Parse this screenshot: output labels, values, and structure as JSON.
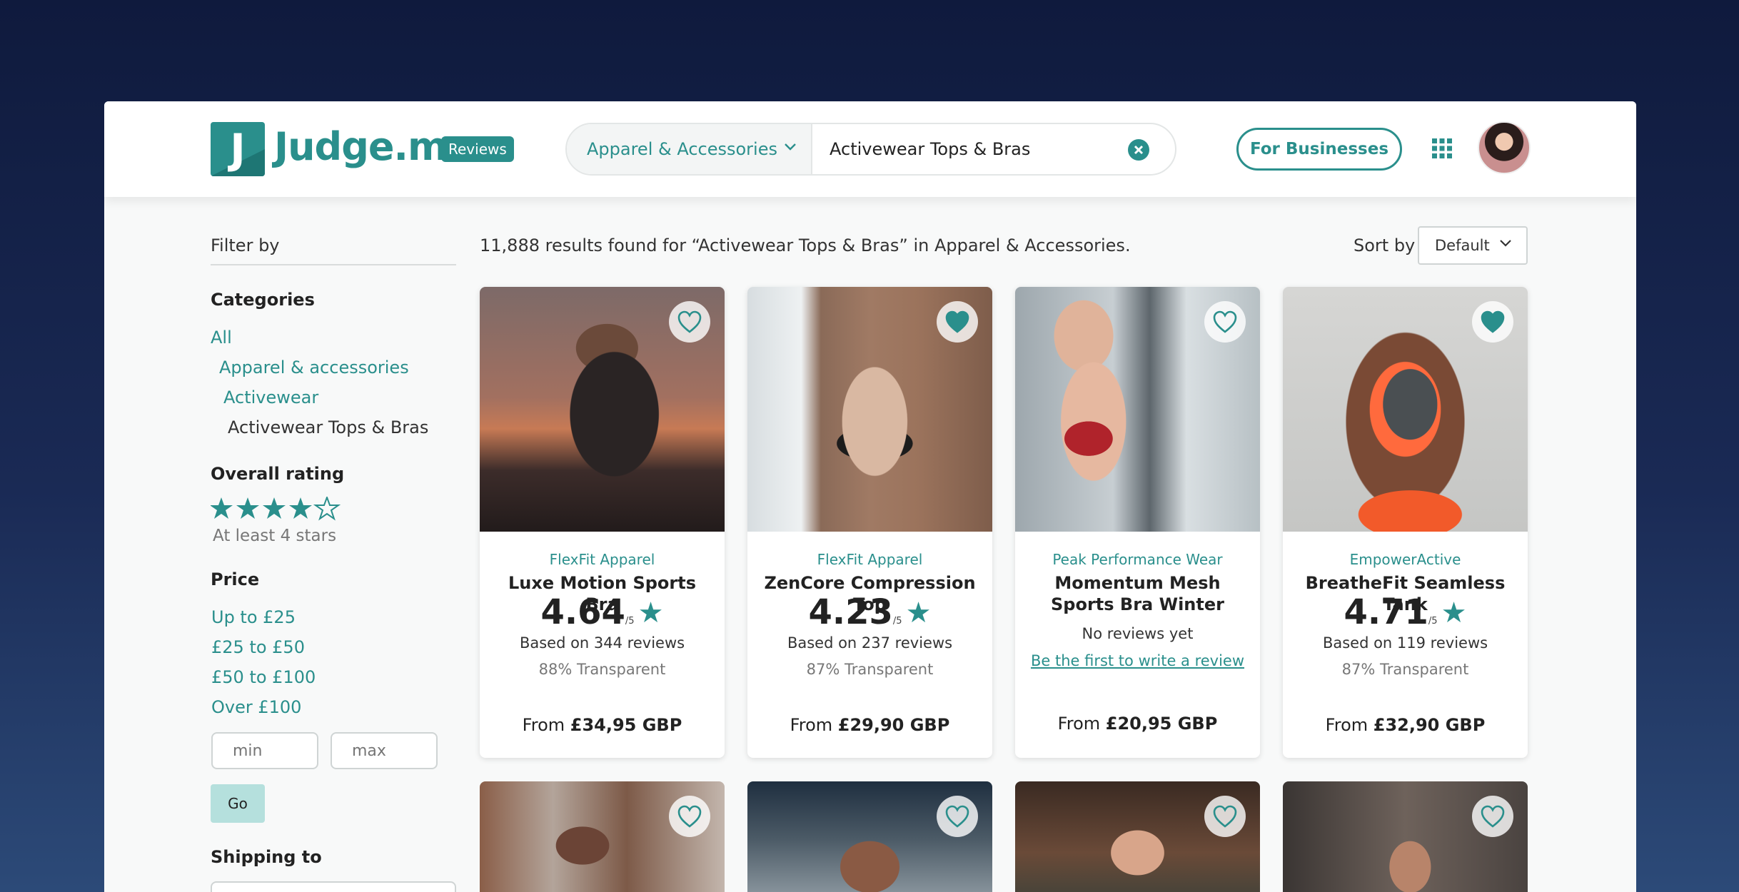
{
  "header": {
    "logo_letter": "J",
    "brand_name": "Judge.me",
    "brand_badge": "Reviews",
    "search_category": "Apparel & Accessories",
    "search_value": "Activewear Tops & Bras",
    "for_businesses": "For Businesses",
    "icons": [
      "chevron-down-icon",
      "clear-icon",
      "apps-grid-icon",
      "avatar"
    ]
  },
  "sidebar": {
    "filter_by": "Filter by",
    "categories_heading": "Categories",
    "categories": [
      "All",
      "Apparel & accessories",
      "Activewear",
      "Activewear Tops & Bras"
    ],
    "rating_heading": "Overall rating",
    "rating_stars_filled": 4,
    "rating_stars_total": 5,
    "rating_note": "At least 4 stars",
    "price_heading": "Price",
    "price_options": [
      "Up to £25",
      "£25 to £50",
      "£50 to £100",
      "Over £100"
    ],
    "min_placeholder": "min",
    "max_placeholder": "max",
    "go_label": "Go",
    "shipping_heading": "Shipping to"
  },
  "results": {
    "summary": "11,888 results found for “Activewear Tops & Bras” in Apparel & Accessories.",
    "sort_label": "Sort by",
    "sort_value": "Default"
  },
  "products": [
    {
      "brand": "FlexFit Apparel",
      "name": "Luxe Motion Sports Bra",
      "rating": "4.64",
      "rating_of": "/5",
      "reviews": "Based on 344 reviews",
      "transparent": "88% Transparent",
      "price_prefix": "From ",
      "price": "£34,95 GBP",
      "favorited": false
    },
    {
      "brand": "FlexFit Apparel",
      "name": "ZenCore Compression Top",
      "rating": "4.23",
      "rating_of": "/5",
      "reviews": "Based on 237 reviews",
      "transparent": "87% Transparent",
      "price_prefix": "From ",
      "price": "£29,90 GBP",
      "favorited": true
    },
    {
      "brand": "Peak Performance Wear",
      "name": "Momentum Mesh Sports Bra Winter",
      "no_reviews": "No reviews yet",
      "write_review": "Be the first to write a review",
      "price_prefix": "From ",
      "price": "£20,95 GBP",
      "favorited": false
    },
    {
      "brand": "EmpowerActive",
      "name": "BreatheFit Seamless Tank",
      "rating": "4.71",
      "rating_of": "/5",
      "reviews": "Based on 119 reviews",
      "transparent": "87% Transparent",
      "price_prefix": "From ",
      "price": "£32,90 GBP",
      "favorited": true
    }
  ],
  "colors": {
    "accent": "#2a8f8c",
    "go_button": "#b5e0dd",
    "page_background_top": "#0f1a3d",
    "page_background_bottom": "#2c4a78"
  }
}
